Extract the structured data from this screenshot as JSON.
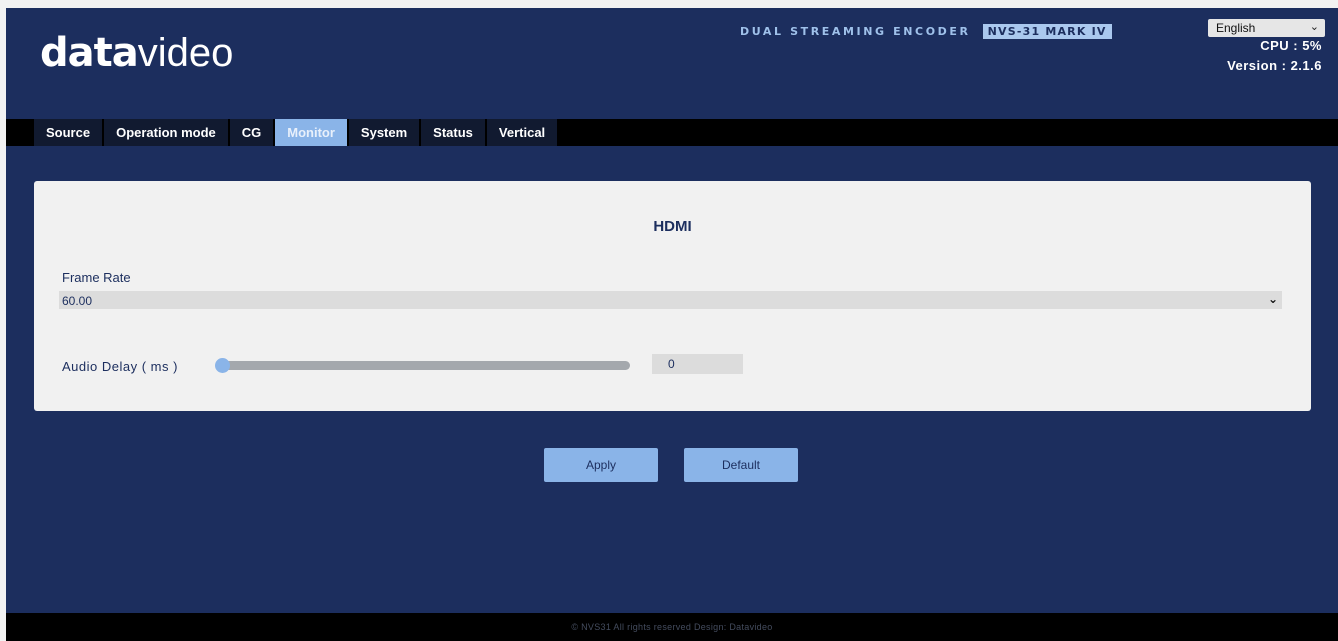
{
  "brand": {
    "logo_bold": "data",
    "logo_thin": "video"
  },
  "header": {
    "product_name": "DUAL STREAMING ENCODER",
    "product_model": "NVS-31 MARK IV",
    "language_selected": "English",
    "cpu": "CPU : 5%",
    "version": "Version : 2.1.6"
  },
  "nav": {
    "tabs": [
      {
        "label": "Source",
        "active": false
      },
      {
        "label": "Operation mode",
        "active": false
      },
      {
        "label": "CG",
        "active": false
      },
      {
        "label": "Monitor",
        "active": true
      },
      {
        "label": "System",
        "active": false
      },
      {
        "label": "Status",
        "active": false
      },
      {
        "label": "Vertical",
        "active": false
      }
    ]
  },
  "panel": {
    "title": "HDMI",
    "frame_rate_label": "Frame Rate",
    "frame_rate_value": "60.00",
    "audio_delay_label": "Audio Delay ( ms )",
    "audio_delay_value": "0",
    "audio_delay_fraction": 0.0
  },
  "buttons": {
    "apply": "Apply",
    "default": "Default"
  },
  "footer": {
    "text": "© NVS31 All rights reserved Design: Datavideo"
  },
  "colors": {
    "background": "#1c2e5e",
    "accent": "#8ab4e8",
    "panel": "#f1f1f1"
  },
  "icons": {
    "language_dropdown": "chevron-down-icon",
    "frame_rate_dropdown": "chevron-down-icon"
  }
}
